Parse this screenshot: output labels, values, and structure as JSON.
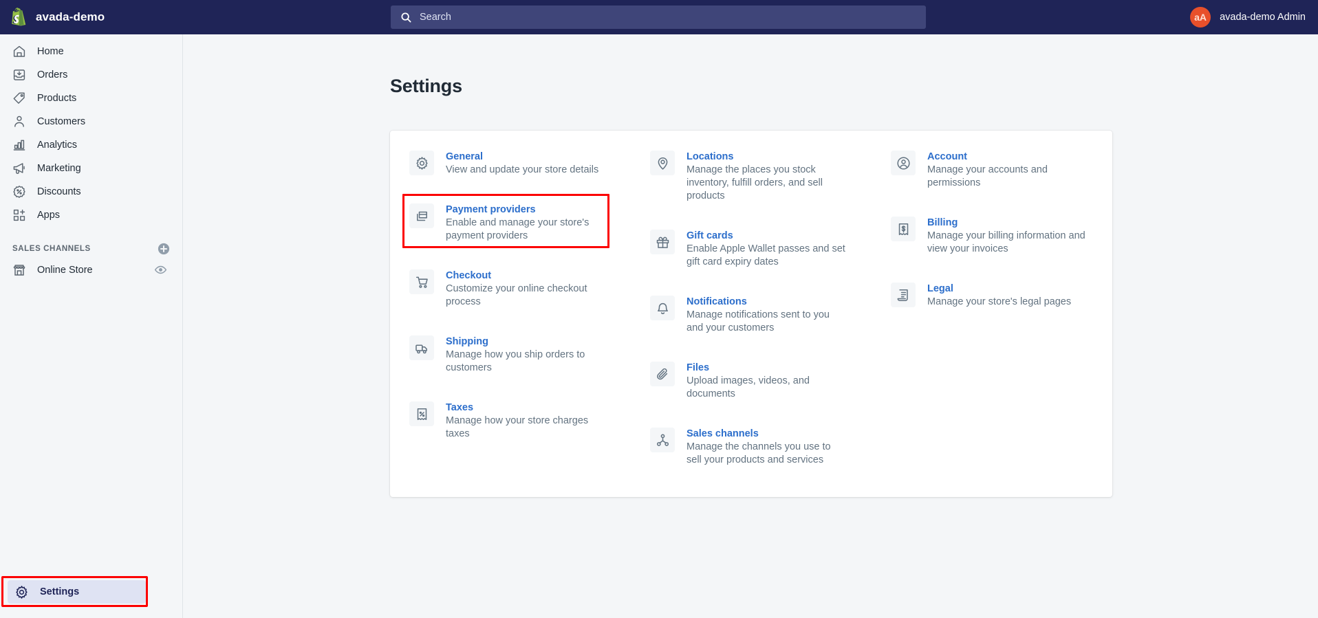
{
  "topbar": {
    "store_name": "avada-demo",
    "logo_icon": "shopify-bag-icon",
    "search": {
      "icon": "search-icon",
      "placeholder": "Search",
      "value": ""
    },
    "user": {
      "initials": "aA",
      "name": "avada-demo Admin",
      "avatar_color": "#e8502b"
    }
  },
  "sidebar": {
    "items": [
      {
        "label": "Home",
        "icon": "home-icon"
      },
      {
        "label": "Orders",
        "icon": "orders-inbox-icon"
      },
      {
        "label": "Products",
        "icon": "tag-icon"
      },
      {
        "label": "Customers",
        "icon": "person-icon"
      },
      {
        "label": "Analytics",
        "icon": "bar-chart-icon"
      },
      {
        "label": "Marketing",
        "icon": "megaphone-icon"
      },
      {
        "label": "Discounts",
        "icon": "discount-percent-icon"
      },
      {
        "label": "Apps",
        "icon": "apps-grid-plus-icon"
      }
    ],
    "sales_channels": {
      "title": "SALES CHANNELS",
      "add_icon": "plus-circle-icon",
      "channels": [
        {
          "label": "Online Store",
          "icon": "storefront-icon",
          "action_icon": "eye-icon"
        }
      ]
    },
    "settings": {
      "label": "Settings",
      "icon": "gear-icon",
      "active": true,
      "highlight_color": "#fc0000"
    }
  },
  "main": {
    "page_title": "Settings",
    "highlight_color": "#fc0000",
    "tiles": [
      {
        "title": "General",
        "desc": "View and update your store details",
        "icon": "gear-icon",
        "column": 1,
        "highlighted": false
      },
      {
        "title": "Payment providers",
        "desc": "Enable and manage your store's payment providers",
        "icon": "payment-cards-icon",
        "column": 1,
        "highlighted": true
      },
      {
        "title": "Checkout",
        "desc": "Customize your online checkout process",
        "icon": "shopping-cart-icon",
        "column": 1,
        "highlighted": false
      },
      {
        "title": "Shipping",
        "desc": "Manage how you ship orders to customers",
        "icon": "delivery-truck-icon",
        "column": 1,
        "highlighted": false
      },
      {
        "title": "Taxes",
        "desc": "Manage how your store charges taxes",
        "icon": "tax-receipt-icon",
        "column": 1,
        "highlighted": false
      },
      {
        "title": "Locations",
        "desc": "Manage the places you stock inventory, fulfill orders, and sell products",
        "icon": "map-pin-icon",
        "column": 2,
        "highlighted": false
      },
      {
        "title": "Gift cards",
        "desc": "Enable Apple Wallet passes and set gift card expiry dates",
        "icon": "gift-icon",
        "column": 2,
        "highlighted": false
      },
      {
        "title": "Notifications",
        "desc": "Manage notifications sent to you and your customers",
        "icon": "bell-icon",
        "column": 2,
        "highlighted": false
      },
      {
        "title": "Files",
        "desc": "Upload images, videos, and documents",
        "icon": "paperclip-icon",
        "column": 2,
        "highlighted": false
      },
      {
        "title": "Sales channels",
        "desc": "Manage the channels you use to sell your products and services",
        "icon": "nodes-graph-icon",
        "column": 2,
        "highlighted": false
      },
      {
        "title": "Account",
        "desc": "Manage your accounts and permissions",
        "icon": "person-circle-icon",
        "column": 3,
        "highlighted": false
      },
      {
        "title": "Billing",
        "desc": "Manage your billing information and view your invoices",
        "icon": "billing-receipt-icon",
        "column": 3,
        "highlighted": false
      },
      {
        "title": "Legal",
        "desc": "Manage your store's legal pages",
        "icon": "legal-scroll-icon",
        "column": 3,
        "highlighted": false
      }
    ]
  }
}
